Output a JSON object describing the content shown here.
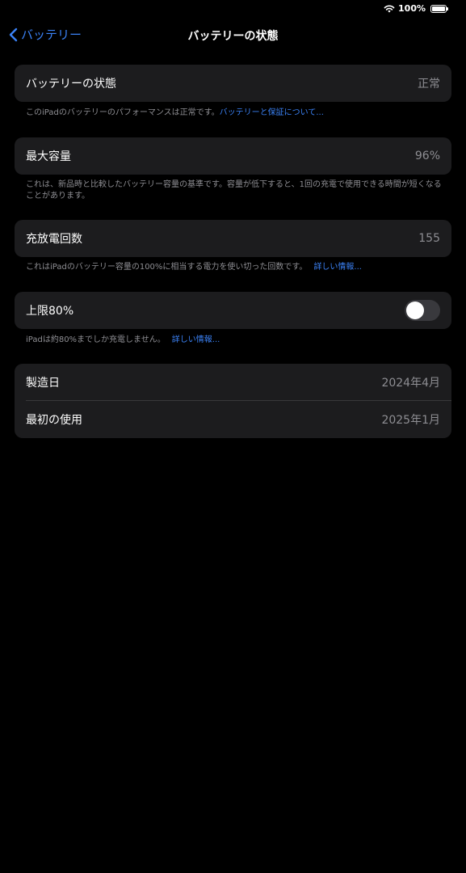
{
  "status_bar": {
    "battery_percent": "100%",
    "battery_level": 1.0
  },
  "nav": {
    "back_label": "バッテリー",
    "title": "バッテリーの状態"
  },
  "battery_health": {
    "label": "バッテリーの状態",
    "value": "正常",
    "footer_text": "このiPadのバッテリーのパフォーマンスは正常です。",
    "footer_link": "バッテリーと保証について..."
  },
  "max_capacity": {
    "label": "最大容量",
    "value": "96%",
    "footer_text": "これは、新品時と比較したバッテリー容量の基準です。容量が低下すると、1回の充電で使用できる時間が短くなることがあります。"
  },
  "cycle_count": {
    "label": "充放電回数",
    "value": "155",
    "footer_text": "これはiPadのバッテリー容量の100%に相当する電力を使い切った回数です。",
    "footer_link": "詳しい情報..."
  },
  "limit_80": {
    "label": "上限80%",
    "enabled": false,
    "footer_text": "iPadは約80%までしか充電しません。",
    "footer_link": "詳しい情報..."
  },
  "dates": {
    "manufacture_label": "製造日",
    "manufacture_value": "2024年4月",
    "first_use_label": "最初の使用",
    "first_use_value": "2025年1月"
  },
  "colors": {
    "accent": "#3b82f6",
    "background": "#000000",
    "group_bg": "#1c1c1e",
    "secondary_text": "#8e8e93"
  },
  "icons": {
    "back": "chevron-left-icon",
    "wifi": "wifi-icon",
    "battery": "battery-icon"
  }
}
